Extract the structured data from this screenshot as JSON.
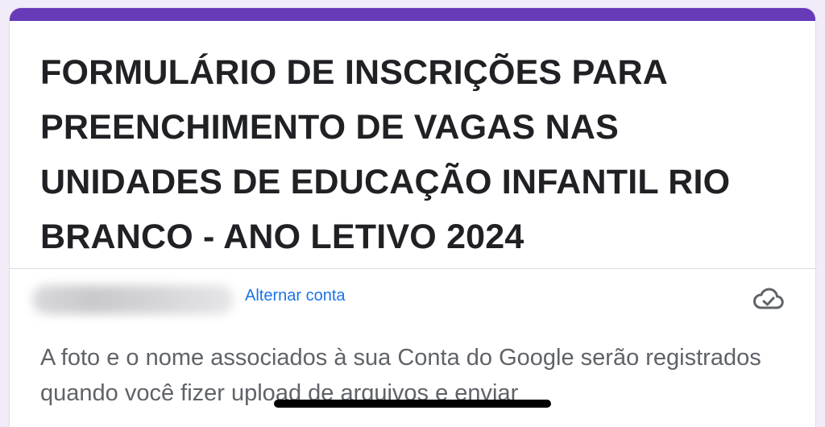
{
  "form": {
    "title": "FORMULÁRIO DE INSCRIÇÕES PARA PREENCHIMENTO DE VAGAS NAS UNIDADES DE EDUCAÇÃO INFANTIL RIO BRANCO - ANO LETIVO 2024",
    "accent_color": "#673ab7"
  },
  "account": {
    "switch_label": "Alternar conta",
    "saved_icon": "cloud-check-icon"
  },
  "notice": {
    "text": "A foto e o nome associados à sua Conta do Google serão registrados quando você fizer upload de arquivos e enviar"
  }
}
